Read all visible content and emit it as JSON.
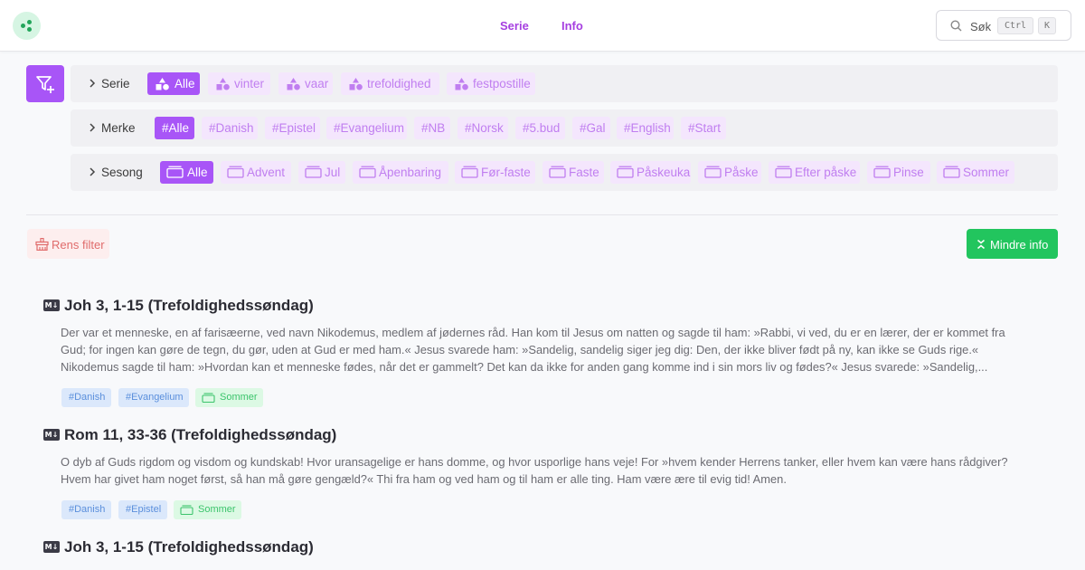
{
  "header": {
    "nav": [
      {
        "label": "Serie"
      },
      {
        "label": "Info"
      }
    ],
    "search": {
      "label": "Søk",
      "kbd1": "Ctrl",
      "kbd2": "K"
    }
  },
  "filters": {
    "serie": {
      "label": "Serie",
      "chips": [
        {
          "label": "Alle",
          "active": true
        },
        {
          "label": "vinter"
        },
        {
          "label": "vaar"
        },
        {
          "label": "trefoldighed"
        },
        {
          "label": "festpostille"
        }
      ]
    },
    "merke": {
      "label": "Merke",
      "chips": [
        {
          "label": "#Alle",
          "active": true
        },
        {
          "label": "#Danish"
        },
        {
          "label": "#Epistel"
        },
        {
          "label": "#Evangelium"
        },
        {
          "label": "#NB"
        },
        {
          "label": "#Norsk"
        },
        {
          "label": "#5.bud"
        },
        {
          "label": "#Gal"
        },
        {
          "label": "#English"
        },
        {
          "label": "#Start"
        }
      ]
    },
    "sesong": {
      "label": "Sesong",
      "chips": [
        {
          "label": "Alle",
          "active": true
        },
        {
          "label": "Advent"
        },
        {
          "label": "Jul"
        },
        {
          "label": "Åpenbaring"
        },
        {
          "label": "Før-faste"
        },
        {
          "label": "Faste"
        },
        {
          "label": "Påskeuka"
        },
        {
          "label": "Påske"
        },
        {
          "label": "Efter påske"
        },
        {
          "label": "Pinse"
        },
        {
          "label": "Sommer"
        }
      ]
    }
  },
  "actions": {
    "clear": "Rens filter",
    "less": "Mindre info"
  },
  "articles": [
    {
      "icon": "M↓",
      "title": "Joh 3, 1-15 (Trefoldighedssøndag)",
      "lines": [
        "Der var et menneske, en af farisæerne, ved navn Nikodemus, medlem af jødernes råd. Han kom til Jesus om natten og sagde til ham: »Rabbi, vi ved, du er en lærer, der er kommet fra",
        "Gud; for ingen kan gøre de tegn, du gør, uden at Gud er med ham.« Jesus svarede ham: »Sandelig, sandelig siger jeg dig: Den, der ikke bliver født på ny, kan ikke se Guds rige.«",
        "Nikodemus sagde til ham: »Hvordan kan et menneske fødes, når det er gammelt? Det kan da ikke for anden gang komme ind i sin mors liv og fødes?« Jesus svarede: »Sandelig,..."
      ],
      "tags": [
        "#Danish",
        "#Evangelium",
        "Sommer"
      ]
    },
    {
      "icon": "M↓",
      "title": "Rom 11, 33-36 (Trefoldighedssøndag)",
      "lines": [
        "O dyb af Guds rigdom og visdom og kundskab! Hvor uransagelige er hans domme, og hvor usporlige hans veje! For »hvem kender Herrens tanker, eller hvem kan være hans rådgiver?",
        "Hvem har givet ham noget først, så han må gøre gengæld?« Thi fra ham og ved ham og til ham er alle ting. Ham være ære til evig tid! Amen."
      ],
      "tags": [
        "#Danish",
        "#Epistel",
        "Sommer"
      ]
    },
    {
      "icon": "M↓",
      "title": "Joh 3, 1-15 (Trefoldighedssøndag)"
    }
  ],
  "colors": {
    "accent": "#a855f7",
    "chip_bg": "#f4e6fd",
    "green": "#22c55e",
    "danger": "#e06b6b"
  }
}
